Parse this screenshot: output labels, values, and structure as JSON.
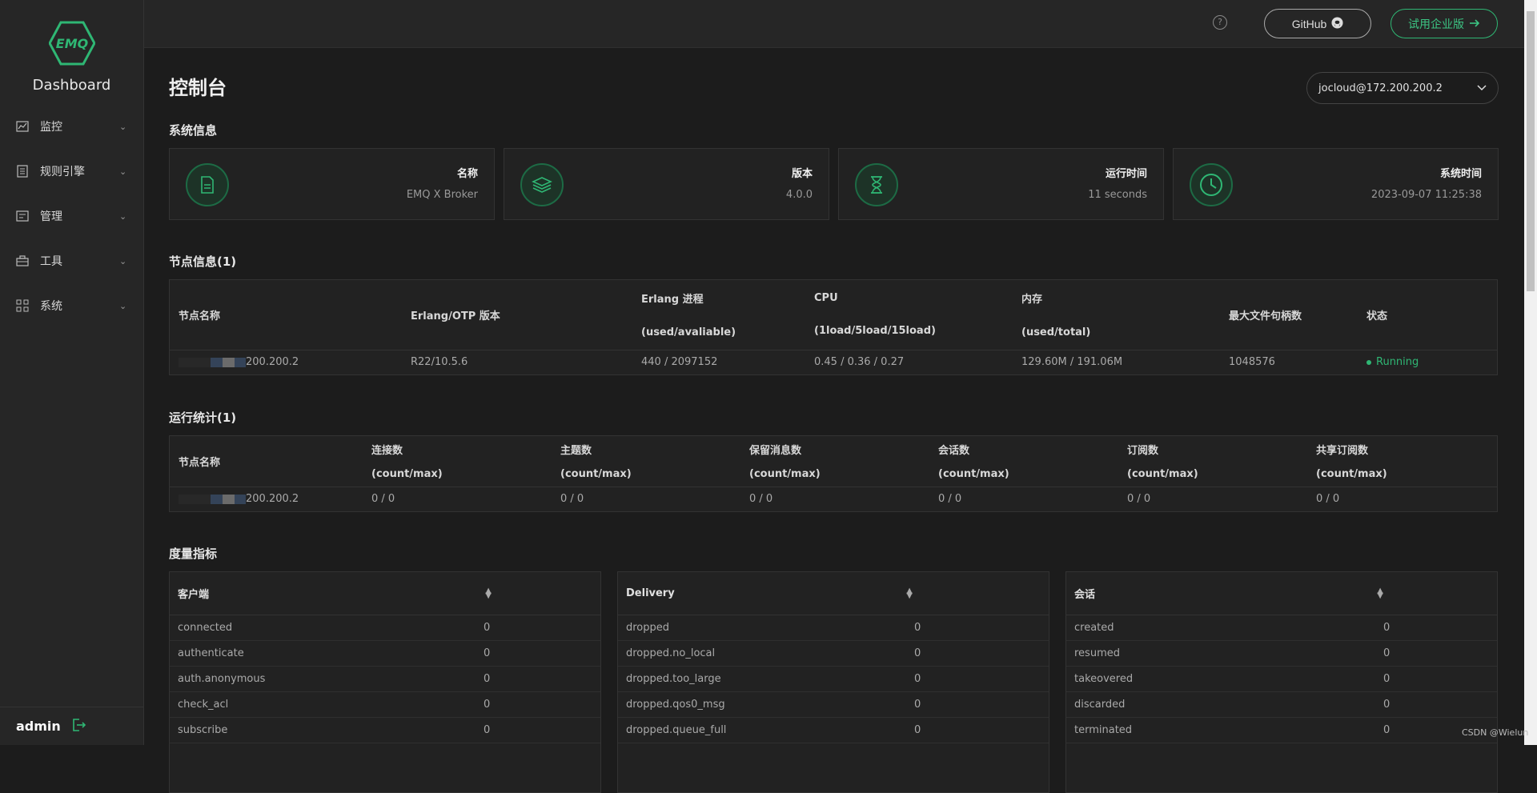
{
  "app": {
    "logo_text": "EMQ",
    "title": "Dashboard"
  },
  "sidebar": {
    "items": [
      {
        "label": "监控",
        "icon": "monitor-chart-icon"
      },
      {
        "label": "规则引擎",
        "icon": "rules-document-icon"
      },
      {
        "label": "管理",
        "icon": "manage-list-icon"
      },
      {
        "label": "工具",
        "icon": "toolbox-icon"
      },
      {
        "label": "系统",
        "icon": "system-grid-icon"
      }
    ],
    "user": "admin"
  },
  "header": {
    "help_symbol": "?",
    "github_label": "GitHub",
    "enterprise_label": "试用企业版"
  },
  "page": {
    "title": "控制台",
    "node_selected": "jocloud@172.200.200.2"
  },
  "system_info": {
    "title": "系统信息",
    "cards": [
      {
        "label": "名称",
        "value": "EMQ X Broker",
        "icon": "document-icon"
      },
      {
        "label": "版本",
        "value": "4.0.0",
        "icon": "layers-icon"
      },
      {
        "label": "运行时间",
        "value": "11 seconds",
        "icon": "hourglass-icon"
      },
      {
        "label": "系统时间",
        "value": "2023-09-07 11:25:38",
        "icon": "clock-icon"
      }
    ]
  },
  "nodes": {
    "title": "节点信息(1)",
    "headers": {
      "name": "节点名称",
      "otp": "Erlang/OTP 版本",
      "proc_1": "Erlang 进程",
      "proc_2": "(used/avaliable)",
      "cpu_1": "CPU",
      "cpu_2": "(1load/5load/15load)",
      "mem_1": "内存",
      "mem_2": "(used/total)",
      "fd": "最大文件句柄数",
      "status": "状态"
    },
    "row": {
      "name": "200.200.2",
      "otp": "R22/10.5.6",
      "proc": "440 / 2097152",
      "cpu": "0.45 / 0.36 / 0.27",
      "mem": "129.60M / 191.06M",
      "fd": "1048576",
      "status": "Running"
    }
  },
  "stats": {
    "title": "运行统计(1)",
    "headers": {
      "name": "节点名称",
      "sub": "(count/max)",
      "conn": "连接数",
      "topics": "主题数",
      "retained": "保留消息数",
      "sessions": "会话数",
      "subs": "订阅数",
      "shared": "共享订阅数"
    },
    "row": {
      "name": "200.200.2",
      "conn": "0 / 0",
      "topics": "0 / 0",
      "retained": "0 / 0",
      "sessions": "0 / 0",
      "subs": "0 / 0",
      "shared": "0 / 0"
    }
  },
  "metrics": {
    "title": "度量指标",
    "client": {
      "title": "客户端",
      "rows": [
        {
          "k": "connected",
          "v": "0"
        },
        {
          "k": "authenticate",
          "v": "0"
        },
        {
          "k": "auth.anonymous",
          "v": "0"
        },
        {
          "k": "check_acl",
          "v": "0"
        },
        {
          "k": "subscribe",
          "v": "0"
        }
      ]
    },
    "delivery": {
      "title": "Delivery",
      "rows": [
        {
          "k": "dropped",
          "v": "0"
        },
        {
          "k": "dropped.no_local",
          "v": "0"
        },
        {
          "k": "dropped.too_large",
          "v": "0"
        },
        {
          "k": "dropped.qos0_msg",
          "v": "0"
        },
        {
          "k": "dropped.queue_full",
          "v": "0"
        }
      ]
    },
    "session": {
      "title": "会话",
      "rows": [
        {
          "k": "created",
          "v": "0"
        },
        {
          "k": "resumed",
          "v": "0"
        },
        {
          "k": "takeovered",
          "v": "0"
        },
        {
          "k": "discarded",
          "v": "0"
        },
        {
          "k": "terminated",
          "v": "0"
        }
      ]
    }
  },
  "watermark": "CSDN @Wielun",
  "colors": {
    "accent": "#2fb774",
    "sidebar_bg": "#262626",
    "page_bg": "#1c1c1c"
  }
}
